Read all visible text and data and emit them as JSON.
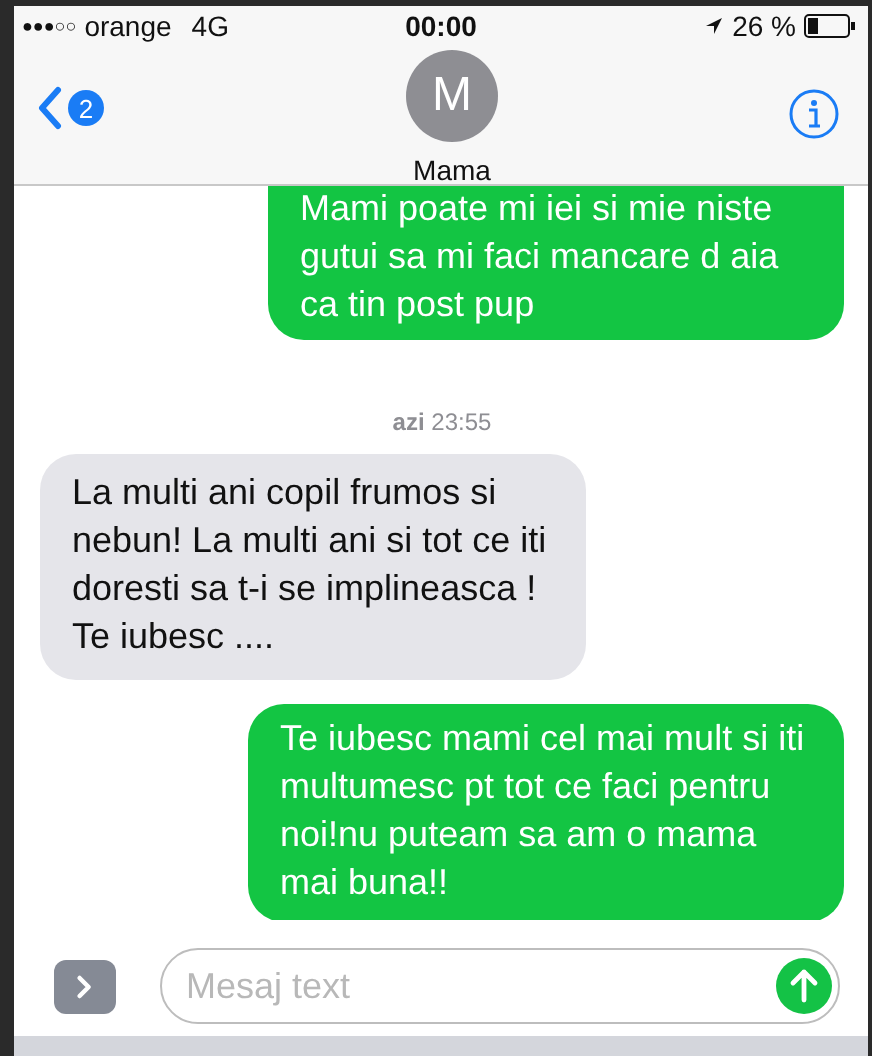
{
  "status_bar": {
    "signal": "●●●○○",
    "carrier": "orange",
    "network": "4G",
    "time": "00:00",
    "battery_percent": "26 %"
  },
  "nav": {
    "back_count": "2",
    "avatar_initial": "M",
    "contact_name": "Mama"
  },
  "messages": [
    {
      "kind": "outgoing",
      "text": "Mami poate mi iei si mie niste gutui sa mi faci mancare d aia ca tin post pup"
    },
    {
      "kind": "timestamp",
      "text": "**azi** 23:55"
    },
    {
      "kind": "incoming",
      "text": "La multi ani copil frumos si nebun!  La multi ani si tot ce iti doresti sa t-i se implineasca ! Te iubesc  ...."
    },
    {
      "kind": "outgoing",
      "text": "Te iubesc mami cel mai mult si iti multumesc pt tot ce faci pentru noi!nu puteam sa am o mama mai buna!!"
    }
  ],
  "composer": {
    "placeholder": "Mesaj text"
  }
}
